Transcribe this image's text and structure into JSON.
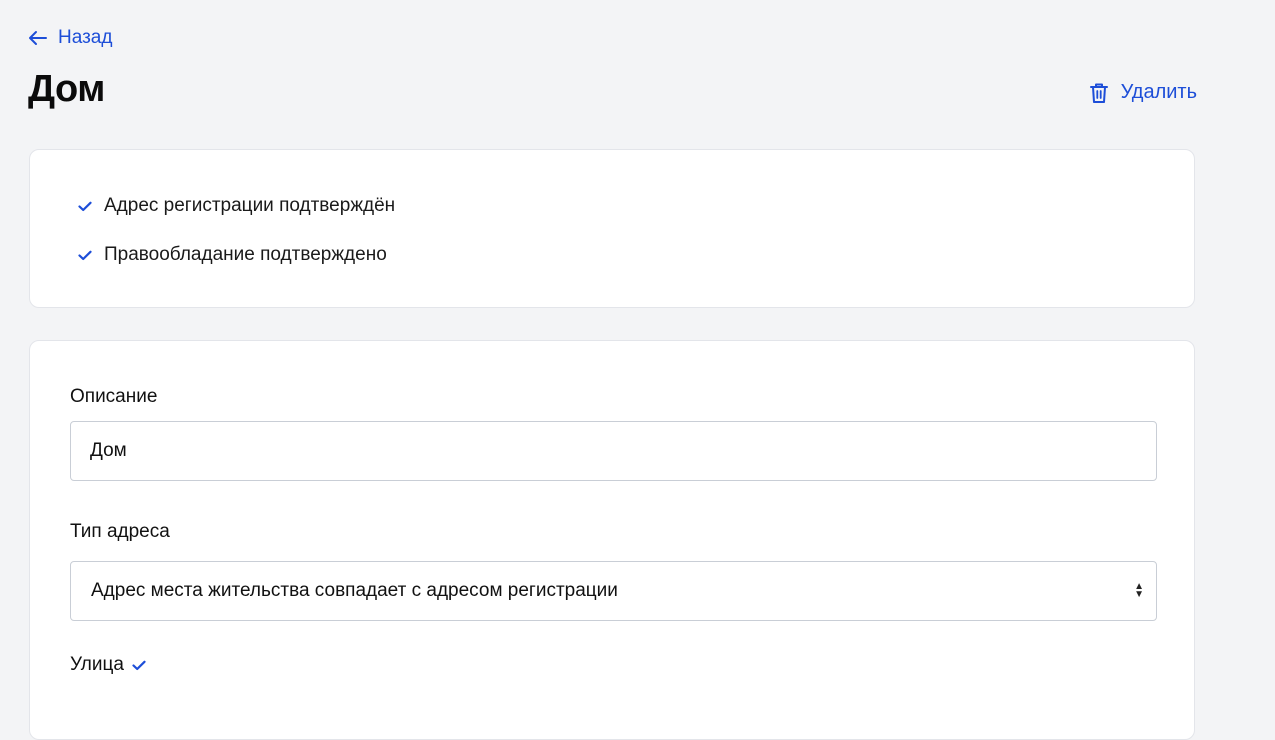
{
  "header": {
    "back_label": "Назад",
    "title": "Дом",
    "delete_label": "Удалить"
  },
  "statuses": [
    {
      "label": "Адрес регистрации подтверждён",
      "icon": "check-icon"
    },
    {
      "label": "Правообладание подтверждено",
      "icon": "check-icon"
    }
  ],
  "form": {
    "description": {
      "label": "Описание",
      "value": "Дом"
    },
    "address_type": {
      "label": "Тип адреса",
      "selected": "Адрес места жительства совпадает с адресом регистрации"
    },
    "street": {
      "label": "Улица",
      "verified_icon": "check-icon"
    }
  },
  "colors": {
    "accent": "#1d4ed8",
    "background": "#f3f4f6",
    "card": "#ffffff"
  }
}
